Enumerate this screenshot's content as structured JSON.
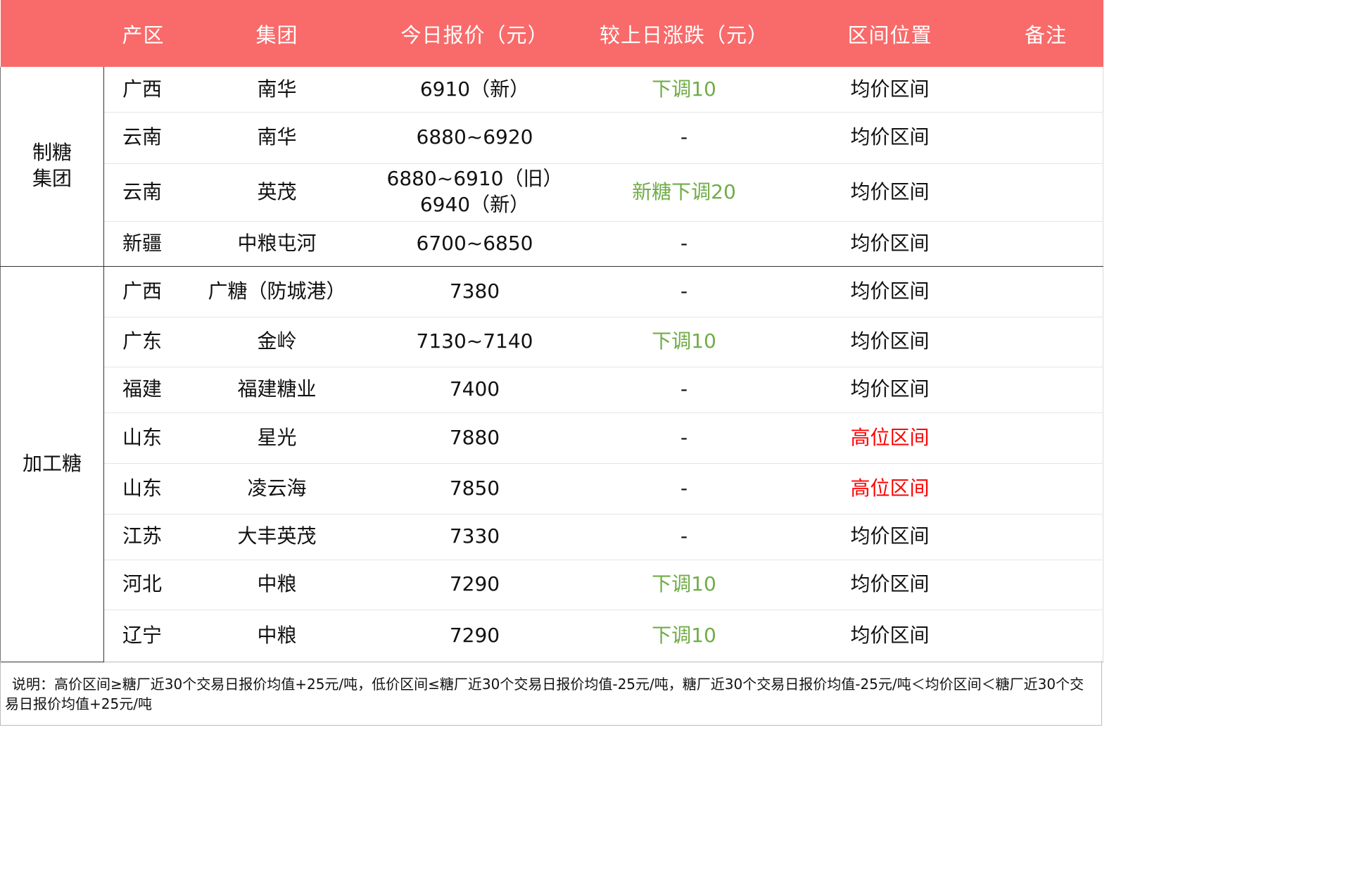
{
  "header": {
    "region": "产区",
    "company": "集团",
    "price": "今日报价（元）",
    "change": "较上日涨跌（元）",
    "position": "区间位置",
    "note": "备注"
  },
  "groups": [
    {
      "name": "制糖集团",
      "rows": [
        {
          "region": "广西",
          "company": "南华",
          "price": "6910（新）",
          "change": "下调10",
          "change_color": "#70ad47",
          "position": "均价区间",
          "note": ""
        },
        {
          "region": "云南",
          "company": "南华",
          "price": "6880~6920",
          "change": "-",
          "change_color": "#111111",
          "position": "均价区间",
          "note": ""
        },
        {
          "region": "云南",
          "company": "英茂",
          "price": "6880~6910（旧）",
          "price_line2": "6940（新）",
          "change": "新糖下调20",
          "change_color": "#70ad47",
          "position": "均价区间",
          "note": ""
        },
        {
          "region": "新疆",
          "company": "中粮屯河",
          "price": "6700~6850",
          "change": "-",
          "change_color": "#111111",
          "position": "均价区间",
          "note": ""
        }
      ]
    },
    {
      "name": "加工糖",
      "rows": [
        {
          "region": "广西",
          "company": "广糖（防城港）",
          "price": "7380",
          "change": "-",
          "change_color": "#111111",
          "position": "均价区间",
          "note": ""
        },
        {
          "region": "广东",
          "company": "金岭",
          "price": "7130~7140",
          "change": "下调10",
          "change_color": "#70ad47",
          "position": "均价区间",
          "note": ""
        },
        {
          "region": "福建",
          "company": "福建糖业",
          "price": "7400",
          "change": "-",
          "change_color": "#111111",
          "position": "均价区间",
          "note": ""
        },
        {
          "region": "山东",
          "company": "星光",
          "price": "7880",
          "change": "-",
          "change_color": "#111111",
          "position": "高位区间",
          "position_color": "#ff0000",
          "note": ""
        },
        {
          "region": "山东",
          "company": "凌云海",
          "price": "7850",
          "change": "-",
          "change_color": "#111111",
          "position": "高位区间",
          "position_color": "#ff0000",
          "note": ""
        },
        {
          "region": "江苏",
          "company": "大丰英茂",
          "price": "7330",
          "change": "-",
          "change_color": "#111111",
          "position": "均价区间",
          "note": ""
        },
        {
          "region": "河北",
          "company": "中粮",
          "price": "7290",
          "change": "下调10",
          "change_color": "#70ad47",
          "position": "均价区间",
          "note": ""
        },
        {
          "region": "辽宁",
          "company": "中粮",
          "price": "7290",
          "change": "下调10",
          "change_color": "#70ad47",
          "position": "均价区间",
          "note": ""
        }
      ]
    }
  ],
  "footnote": "说明：高价区间≥糖厂近30个交易日报价均值+25元/吨，低价区间≤糖厂近30个交易日报价均值-25元/吨，糖厂近30个交易日报价均值-25元/吨＜均价区间＜糖厂近30个交易日报价均值+25元/吨",
  "colors": {
    "header_bg": "#f96a6a",
    "header_text": "#ffffff",
    "decline": "#70ad47",
    "high_position": "#ff0000"
  }
}
